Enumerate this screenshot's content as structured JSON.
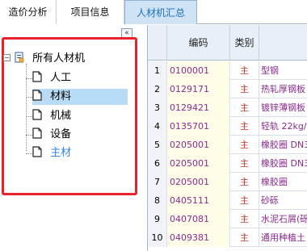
{
  "tabs": [
    {
      "label": "造价分析",
      "active": false
    },
    {
      "label": "项目信息",
      "active": false
    },
    {
      "label": "人材机汇总",
      "active": true
    }
  ],
  "left_panel": {
    "collapse_symbol": "«",
    "expander_symbol": "−",
    "root": {
      "label": "所有人材机",
      "icon": "tree-root-icon"
    },
    "children": [
      {
        "label": "人工",
        "icon": "document-icon",
        "selected": false,
        "highlight": false
      },
      {
        "label": "材料",
        "icon": "document-icon",
        "selected": true,
        "highlight": false
      },
      {
        "label": "机械",
        "icon": "document-icon",
        "selected": false,
        "highlight": false
      },
      {
        "label": "设备",
        "icon": "document-icon",
        "selected": false,
        "highlight": false
      },
      {
        "label": "主材",
        "icon": "document-icon",
        "selected": false,
        "highlight": true
      }
    ],
    "frame_color": "#e8212b"
  },
  "grid": {
    "columns": {
      "index": "",
      "code": "编码",
      "type": "类别",
      "name": ""
    },
    "rows": [
      {
        "index": "1",
        "code": "0100001",
        "type": "主",
        "name": "型钢"
      },
      {
        "index": "2",
        "code": "0129171",
        "type": "主",
        "name": "热轧厚钢板"
      },
      {
        "index": "3",
        "code": "0129421",
        "type": "主",
        "name": "镀锌薄钢板"
      },
      {
        "index": "4",
        "code": "0135701",
        "type": "主",
        "name": "轻轨 22kg/"
      },
      {
        "index": "5",
        "code": "0205001",
        "type": "主",
        "name": "橡胶圈 DN3"
      },
      {
        "index": "6",
        "code": "0205001",
        "type": "主",
        "name": "橡胶圈 DN3"
      },
      {
        "index": "7",
        "code": "0205001",
        "type": "主",
        "name": "橡胶圈"
      },
      {
        "index": "8",
        "code": "0405111",
        "type": "主",
        "name": "砂砾"
      },
      {
        "index": "9",
        "code": "0407081",
        "type": "主",
        "name": "水泥石屑(砾"
      },
      {
        "index": "10",
        "code": "0409381",
        "type": "主",
        "name": "通用种植土"
      }
    ]
  },
  "colors": {
    "active_tab_bg": "#cfe3f5",
    "active_tab_text": "#1a6fb5",
    "code_text": "#8a2a8f",
    "type_text": "#c0392b",
    "selected_bg": "#b9dcf6",
    "highlight_text": "#2f87d8"
  }
}
